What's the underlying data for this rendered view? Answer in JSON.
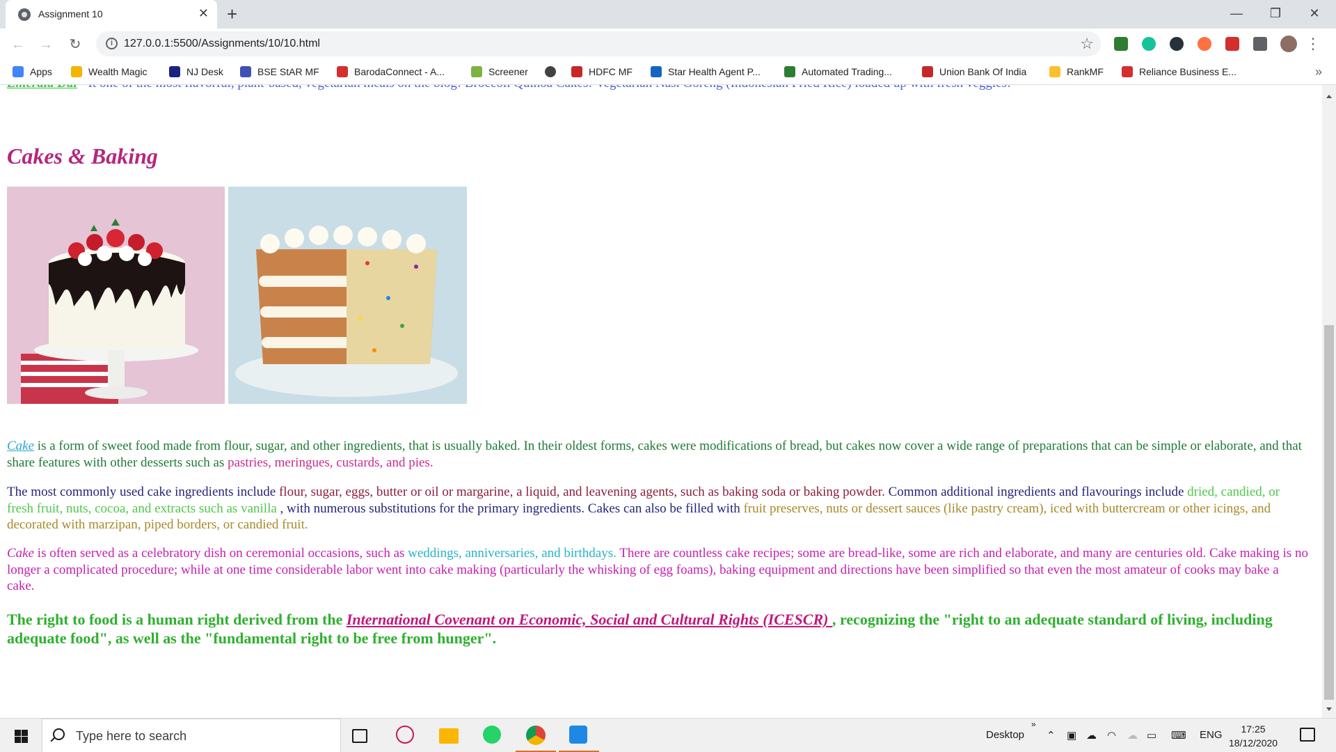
{
  "browser": {
    "tab_title": "Assignment 10",
    "url": "127.0.0.1:5500/Assignments/10/10.html",
    "bookmarks": [
      {
        "label": "Apps",
        "color": "#4285f4"
      },
      {
        "label": "Wealth Magic",
        "color": "#f4b400"
      },
      {
        "label": "NJ Desk",
        "color": "#1a237e"
      },
      {
        "label": "BSE StAR MF",
        "color": "#3f51b5"
      },
      {
        "label": "BarodaConnect - A...",
        "color": "#d32f2f"
      },
      {
        "label": "Screener",
        "color": "#7cb342"
      },
      {
        "label": "",
        "color": "#424242"
      },
      {
        "label": "HDFC MF",
        "color": "#c62828"
      },
      {
        "label": "Star Health Agent P...",
        "color": "#1565c0"
      },
      {
        "label": "Automated Trading...",
        "color": "#2e7d32"
      },
      {
        "label": "Union Bank Of India",
        "color": "#c62828"
      },
      {
        "label": "RankMF",
        "color": "#fbc02d"
      },
      {
        "label": "Reliance Business E...",
        "color": "#d32f2f"
      }
    ]
  },
  "page": {
    "top_line": {
      "link": "Emerald Dal",
      "text": " - It one of the most flavorful, plant-based, vegetarian meals on the blog! Broccoli Quinoa Cakes! Vegetarian Nasi Goreng (Indonesian Fried Rice) loaded up with fresh veggies!"
    },
    "heading": "Cakes & Baking",
    "p1": {
      "link": "Cake",
      "text": " is a form of sweet food made from flour, sugar, and other ingredients, that is usually baked. In their oldest forms, cakes were modifications of bread, but cakes now cover a wide range of preparations that can be simple or elaborate, and that share features with other desserts such as ",
      "highlight": "pastries, meringues, custards, and pies."
    },
    "p2": {
      "t1": "The most commonly used cake ingredients include ",
      "t2": "flour, sugar, eggs, butter or oil or margarine, a liquid, and leavening agents, such as baking soda or baking powder.",
      "t3": " Common additional ingredients and flavourings include ",
      "t4": "dried, candied, or fresh fruit, nuts, cocoa, and extracts such as vanilla",
      "t5": " , with numerous substitutions for the primary ingredients. Cakes can also be filled with ",
      "t6": "fruit preserves, nuts or dessert sauces (like pastry cream), iced with buttercream or other icings, and decorated with marzipan, piped borders, or candied fruit."
    },
    "p3": {
      "t1": "Cake",
      "t2": " is often served as a celebratory dish on ceremonial occasions, such as ",
      "t3": "weddings, anniversaries, and birthdays.",
      "t4": " There are countless cake recipes; some are bread-like, some are rich and elaborate, and many are centuries old. Cake making is no longer a complicated procedure; while at one time considerable labor went into cake making (particularly the whisking of egg foams), baking equipment and directions have been simplified so that even the most amateur of cooks may bake a cake."
    },
    "p4": {
      "t1": "The right to food is a human right derived from the ",
      "link": "International Covenant on Economic, Social and Cultural Rights (ICESCR) ",
      "t2": ", recognizing the \"right to an adequate standard of living, including adequate food\", as well as the \"fundamental right to be free from hunger\"."
    }
  },
  "taskbar": {
    "search_placeholder": "Type here to search",
    "desktop_label": "Desktop",
    "lang": "ENG",
    "time": "17:25",
    "date": "18/12/2020"
  }
}
